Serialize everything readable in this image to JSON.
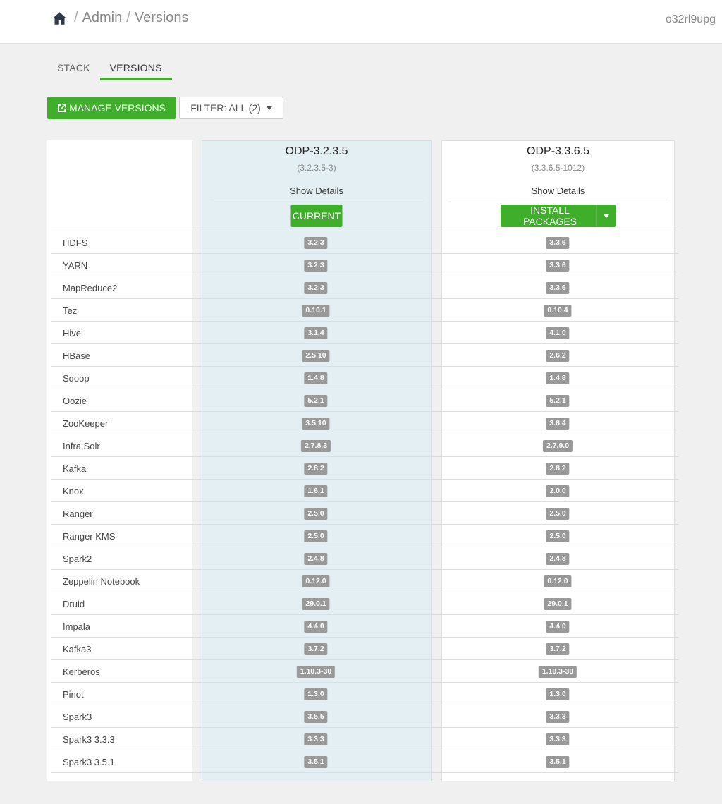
{
  "header": {
    "breadcrumb": {
      "home_icon": "home-icon",
      "admin": "Admin",
      "current": "Versions",
      "separator": "/"
    },
    "username": "o32rl9upg"
  },
  "tabs": [
    {
      "label": "STACK",
      "active": false
    },
    {
      "label": "VERSIONS",
      "active": true
    }
  ],
  "toolbar": {
    "manage_versions_label": "MANAGE VERSIONS",
    "manage_icon": "external-link-icon",
    "filter_label": "FILTER: ALL (2)"
  },
  "colors": {
    "accent": "#3fae2a",
    "badge": "#999999",
    "current_column_bg": "#e4eff3"
  },
  "versions": [
    {
      "name": "ODP-3.2.3.5",
      "build": "(3.2.3.5-3)",
      "details_label": "Show Details",
      "action_label": "CURRENT"
    },
    {
      "name": "ODP-3.3.6.5",
      "build": "(3.3.6.5-1012)",
      "details_label": "Show Details",
      "action_label": "INSTALL PACKAGES"
    }
  ],
  "services": [
    {
      "name": "HDFS",
      "v1": "3.2.3",
      "v2": "3.3.6"
    },
    {
      "name": "YARN",
      "v1": "3.2.3",
      "v2": "3.3.6"
    },
    {
      "name": "MapReduce2",
      "v1": "3.2.3",
      "v2": "3.3.6"
    },
    {
      "name": "Tez",
      "v1": "0.10.1",
      "v2": "0.10.4"
    },
    {
      "name": "Hive",
      "v1": "3.1.4",
      "v2": "4.1.0"
    },
    {
      "name": "HBase",
      "v1": "2.5.10",
      "v2": "2.6.2"
    },
    {
      "name": "Sqoop",
      "v1": "1.4.8",
      "v2": "1.4.8"
    },
    {
      "name": "Oozie",
      "v1": "5.2.1",
      "v2": "5.2.1"
    },
    {
      "name": "ZooKeeper",
      "v1": "3.5.10",
      "v2": "3.8.4"
    },
    {
      "name": "Infra Solr",
      "v1": "2.7.8.3",
      "v2": "2.7.9.0"
    },
    {
      "name": "Kafka",
      "v1": "2.8.2",
      "v2": "2.8.2"
    },
    {
      "name": "Knox",
      "v1": "1.6.1",
      "v2": "2.0.0"
    },
    {
      "name": "Ranger",
      "v1": "2.5.0",
      "v2": "2.5.0"
    },
    {
      "name": "Ranger KMS",
      "v1": "2.5.0",
      "v2": "2.5.0"
    },
    {
      "name": "Spark2",
      "v1": "2.4.8",
      "v2": "2.4.8"
    },
    {
      "name": "Zeppelin Notebook",
      "v1": "0.12.0",
      "v2": "0.12.0"
    },
    {
      "name": "Druid",
      "v1": "29.0.1",
      "v2": "29.0.1"
    },
    {
      "name": "Impala",
      "v1": "4.4.0",
      "v2": "4.4.0"
    },
    {
      "name": "Kafka3",
      "v1": "3.7.2",
      "v2": "3.7.2"
    },
    {
      "name": "Kerberos",
      "v1": "1.10.3-30",
      "v2": "1.10.3-30"
    },
    {
      "name": "Pinot",
      "v1": "1.3.0",
      "v2": "1.3.0"
    },
    {
      "name": "Spark3",
      "v1": "3.5.5",
      "v2": "3.3.3"
    },
    {
      "name": "Spark3 3.3.3",
      "v1": "3.3.3",
      "v2": "3.3.3"
    },
    {
      "name": "Spark3 3.5.1",
      "v1": "3.5.1",
      "v2": "3.5.1"
    }
  ]
}
